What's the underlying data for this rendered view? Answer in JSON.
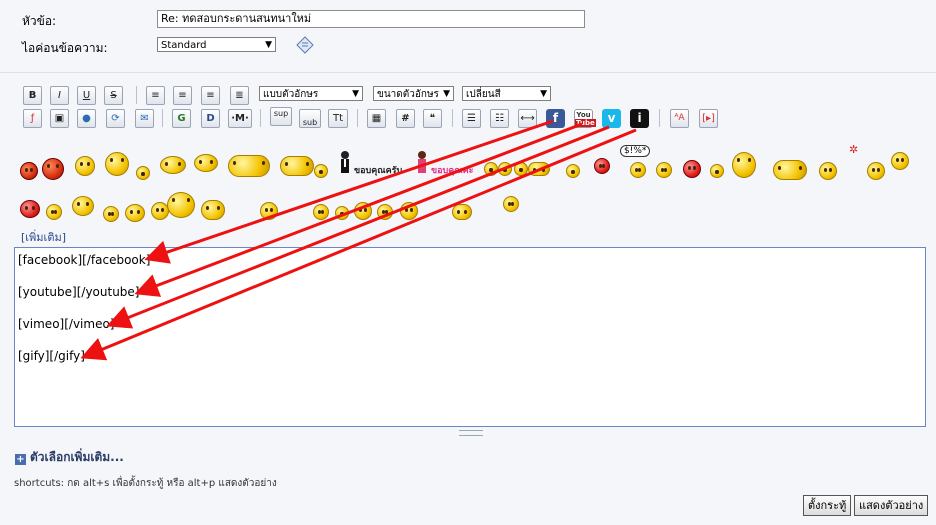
{
  "form": {
    "subject_label": "หัวข้อ:",
    "subject_value": "Re: ทดสอบกระดานสนทนาใหม่",
    "icon_label": "ไอค่อนข้อความ:",
    "icon_value": "Standard"
  },
  "toolbar": {
    "font_select": "แบบตัวอักษร",
    "size_select": "ขนาดตัวอักษร",
    "color_select": "เปลี่ยนสี",
    "bold": "B",
    "italic": "I",
    "underline": "U",
    "strike": "S",
    "sup": "sup",
    "sub": "sub",
    "tt": "Tt",
    "hash": "#",
    "youtube": "You",
    "youtube2": "Tube",
    "vimeo": "v",
    "gify": "i",
    "facebook": "f"
  },
  "smilies": {
    "thanks_male": "ขอบคุณครับ",
    "thanks_female": "ขอบคุณค่ะ",
    "more": "[เพิ่มเติม]"
  },
  "editor": {
    "lines": [
      "[facebook][/facebook]",
      "[youtube][/youtube]",
      "[vimeo][/vimeo]",
      "[gify][/gify]"
    ]
  },
  "footer": {
    "more_options": "ตัวเลือกเพิ่มเติม...",
    "shortcuts": "shortcuts: กด alt+s เพื่อตั้งกระทู้ หรือ alt+p แสดงตัวอย่าง",
    "post_button": "ตั้งกระทู้",
    "preview_button": "แสดงตัวอย่าง"
  },
  "colors": {
    "arrow": "#ee1111",
    "editor_border": "#6b86c6",
    "facebook": "#3b5998",
    "youtube": "#cc181e",
    "vimeo": "#1ab7ea"
  }
}
